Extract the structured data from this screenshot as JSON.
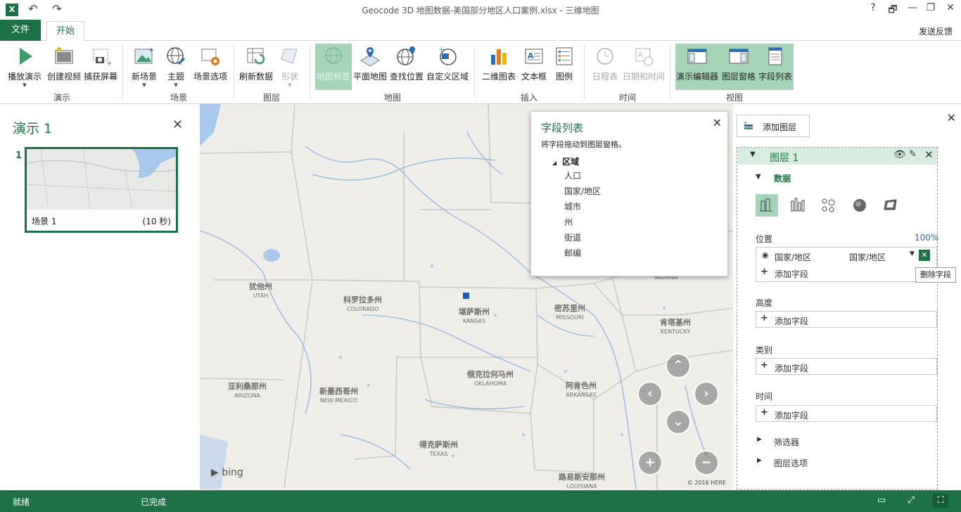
{
  "window": {
    "title": "Geocode 3D 地图数据-美国部分地区人口案例.xlsx - 三维地图",
    "app_icon": "X",
    "buttons": {
      "help": "?",
      "restore_down": "🗗",
      "minimize": "—",
      "maximize": "❐",
      "close": "✕"
    },
    "qat": {
      "undo": "↶",
      "redo": "↷"
    }
  },
  "tabs": {
    "file": "文件",
    "home": "开始",
    "feedback": "发送反馈"
  },
  "ribbon": {
    "groups": {
      "tour": "演示",
      "scene": "场景",
      "layer": "图层",
      "map": "地图",
      "insert": "插入",
      "time": "时间",
      "view": "视图"
    },
    "buttons": {
      "play_tour": "播放演示",
      "create_video": "创建视频",
      "capture_screen": "捕获屏幕",
      "new_scene": "新场景",
      "theme": "主题",
      "scene_options": "场景选项",
      "refresh_data": "刷新数据",
      "shapes": "形状",
      "map_labels": "地图标签",
      "flat_map": "平面地图",
      "find_location": "查找位置",
      "custom_regions": "自定义区域",
      "chart_2d": "二维图表",
      "text_box": "文本框",
      "legend": "图例",
      "timeline": "日程表",
      "date_time": "日期和时间",
      "tour_editor": "演示编辑器",
      "layer_pane": "图层窗格",
      "field_list": "字段列表"
    }
  },
  "tour_panel": {
    "title": "演示 1",
    "close": "✕",
    "scene_number": "1",
    "scene_name": "场景 1",
    "scene_duration": "(10 秒)"
  },
  "map": {
    "labels": {
      "utah": "犹他州",
      "utah_en": "UTAH",
      "colorado": "科罗拉多州",
      "colorado_en": "COLORADO",
      "kansas": "堪萨斯州",
      "kansas_en": "KANSAS",
      "missouri": "密苏里州",
      "missouri_en": "MISSOURI",
      "kentucky": "肯塔基州",
      "kentucky_en": "KENTUCKY",
      "arizona": "亚利桑那州",
      "arizona_en": "ARIZONA",
      "new_mexico": "新墨西哥州",
      "new_mexico_en": "NEW MEXICO",
      "oklahoma": "俄克拉何马州",
      "oklahoma_en": "OKLAHOMA",
      "arkansas": "阿肯色州",
      "arkansas_en": "ARKANSAS",
      "texas": "得克萨斯州",
      "texas_en": "TEXAS",
      "louisiana": "路易斯安那州",
      "louisiana_en": "LOUISIANA",
      "indiana_en": "INDIANA"
    },
    "bing": "bing",
    "copyright": "© 2016 HERE",
    "data_point_color": "#1f5fa8"
  },
  "field_list": {
    "title": "字段列表",
    "subtitle": "将字段拖动到图层窗格。",
    "group": "区域",
    "items": [
      "人口",
      "国家/地区",
      "城市",
      "州",
      "街道",
      "邮编"
    ],
    "close": "✕"
  },
  "layer_pane": {
    "add_layer": "添加图层",
    "close": "✕",
    "layer_name": "图层 1",
    "data_section": "数据",
    "location_label": "位置",
    "location_percent": "100%",
    "location_field": "国家/地区",
    "location_type": "国家/地区",
    "add_field": "添加字段",
    "height_label": "高度",
    "category_label": "类别",
    "time_label": "时间",
    "filters": "筛选器",
    "layer_options": "图层选项",
    "tooltip": "删除字段"
  },
  "status": {
    "ready": "就绪",
    "done": "已完成"
  },
  "colors": {
    "accent": "#1e7145",
    "selected": "#a6d4b8",
    "map_bg": "#eeede8",
    "water": "#a8c8ec"
  }
}
